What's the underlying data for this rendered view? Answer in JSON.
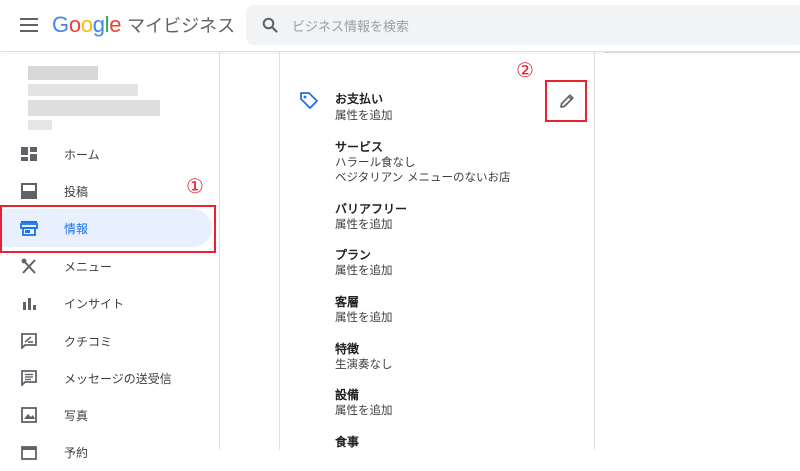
{
  "header": {
    "logo": [
      "G",
      "o",
      "o",
      "g",
      "l",
      "e"
    ],
    "product_name": "マイビジネス",
    "search_placeholder": "ビジネス情報を検索"
  },
  "sidebar": {
    "items": [
      {
        "label": "ホーム",
        "icon": "dashboard-icon"
      },
      {
        "label": "投稿",
        "icon": "post-icon"
      },
      {
        "label": "情報",
        "icon": "storefront-icon",
        "active": true
      },
      {
        "label": "メニュー",
        "icon": "utensils-icon"
      },
      {
        "label": "インサイト",
        "icon": "bar-chart-icon"
      },
      {
        "label": "クチコミ",
        "icon": "review-icon"
      },
      {
        "label": "メッセージの送受信",
        "icon": "message-icon"
      },
      {
        "label": "写真",
        "icon": "photo-icon"
      },
      {
        "label": "予約",
        "icon": "calendar-icon"
      }
    ]
  },
  "annotations": {
    "one": "①",
    "two": "②"
  },
  "attributes": [
    {
      "title": "お支払い",
      "values": [
        "属性を追加"
      ]
    },
    {
      "title": "サービス",
      "values": [
        "ハラール食なし",
        "ベジタリアン メニューのないお店"
      ]
    },
    {
      "title": "バリアフリー",
      "values": [
        "属性を追加"
      ]
    },
    {
      "title": "プラン",
      "values": [
        "属性を追加"
      ]
    },
    {
      "title": "客層",
      "values": [
        "属性を追加"
      ]
    },
    {
      "title": "特徴",
      "values": [
        "生演奏なし"
      ]
    },
    {
      "title": "設備",
      "values": [
        "属性を追加"
      ]
    },
    {
      "title": "食事",
      "values": []
    }
  ],
  "colors": {
    "accent": "#1a73e8",
    "annotation": "#e8232f",
    "active_bg": "#e8f0fe"
  }
}
